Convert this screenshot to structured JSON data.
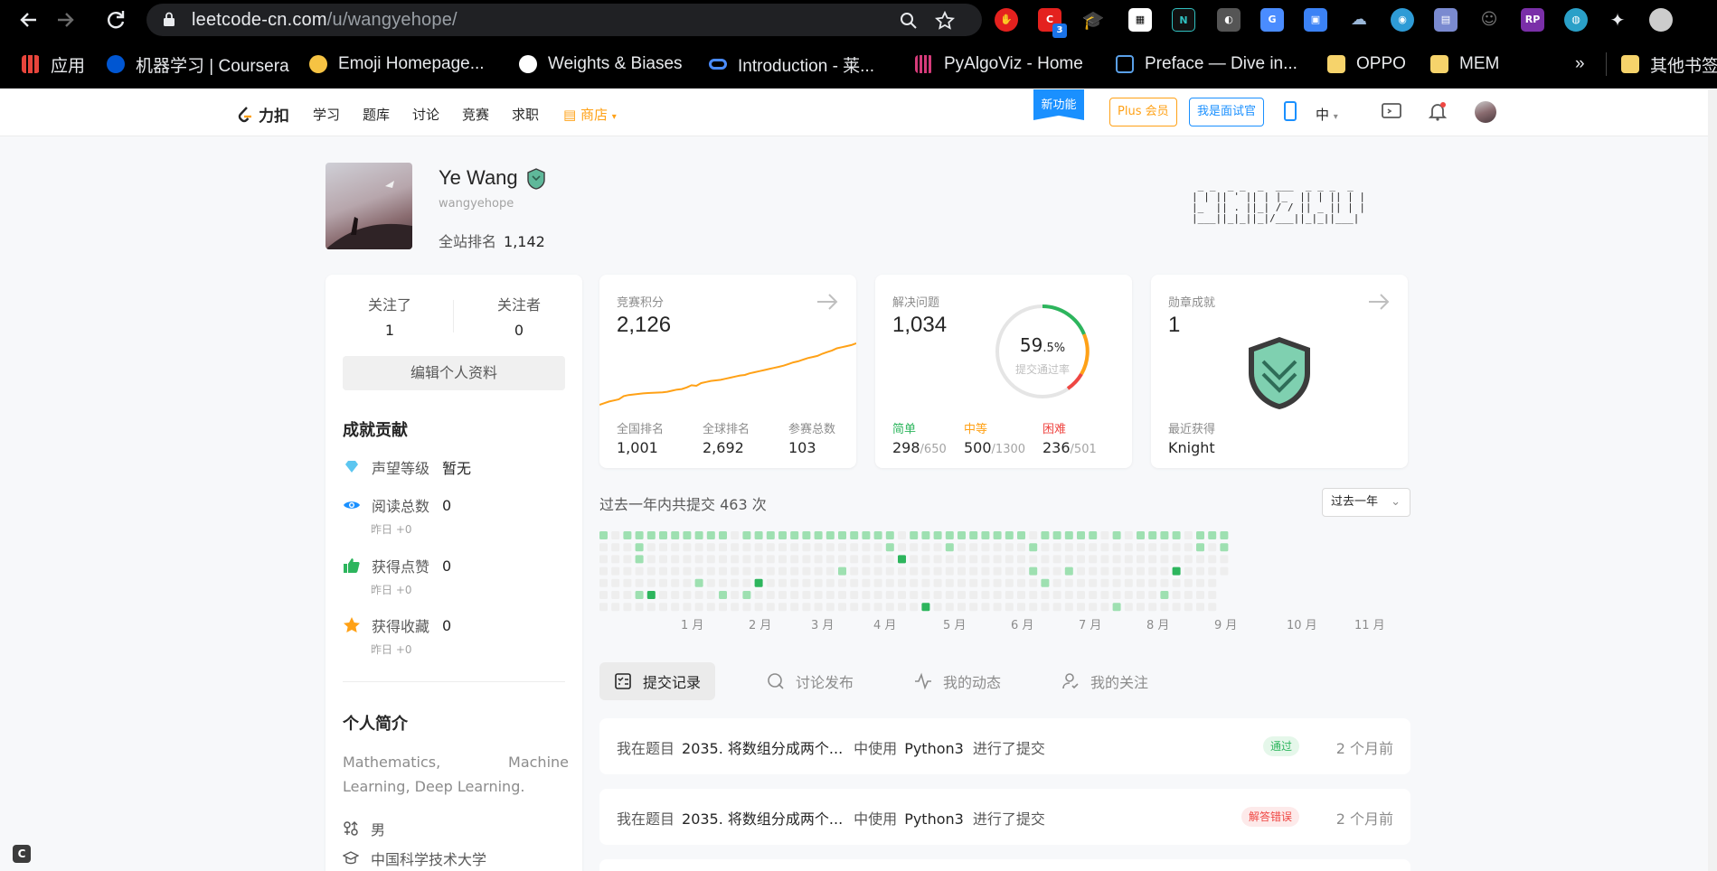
{
  "browser": {
    "url_host": "leetcode-cn.com",
    "url_path": "/u/wangyehope/",
    "bookmarks": [
      {
        "label": "应用",
        "color": "#e8453c"
      },
      {
        "label": "机器学习 | Coursera",
        "color": "#0056d2"
      },
      {
        "label": "Emoji Homepage...",
        "color": "#f6c343"
      },
      {
        "label": "Weights & Biases",
        "color": "#ffffff"
      },
      {
        "label": "Introduction - 莱...",
        "color": "#4a8cff"
      },
      {
        "label": "PyAlgoViz - Home",
        "color": "#d63b7a"
      },
      {
        "label": "Preface — Dive in...",
        "color": "#5aa0e8"
      },
      {
        "label": "OPPO",
        "color": "#f6d36b"
      },
      {
        "label": "MEM",
        "color": "#f6d36b"
      }
    ],
    "bookmarks_overflow": "»",
    "other_bookmarks": "其他书签",
    "extension_badge": "3"
  },
  "site": {
    "logo": "力扣",
    "nav": [
      "学习",
      "题库",
      "讨论",
      "竞赛",
      "求职"
    ],
    "shop": "商店",
    "new_feature": "新功能",
    "plus": "Plus 会员",
    "interviewer": "我是面试官",
    "lang": "中"
  },
  "profile": {
    "name": "Ye Wang",
    "handle": "wangyehope",
    "rank_label": "全站排名",
    "rank_value": "1,142",
    "ascii_art": " _ _  _ _  _  ___  _ _ _  _ \n| | || ' || | |_  || | || | |\n|_  || . ||_| / / || _ || | |\n|___||_|_||_|/___||_|_||___|"
  },
  "left": {
    "following_label": "关注了",
    "following_value": "1",
    "followers_label": "关注者",
    "followers_value": "0",
    "edit_button": "编辑个人资料",
    "achievements_title": "成就贡献",
    "reputation_label": "声望等级",
    "reputation_value": "暂无",
    "views_label": "阅读总数",
    "views_value": "0",
    "views_sub": "昨日 +0",
    "likes_label": "获得点赞",
    "likes_value": "0",
    "likes_sub": "昨日 +0",
    "favs_label": "获得收藏",
    "favs_value": "0",
    "favs_sub": "昨日 +0",
    "bio_title": "个人简介",
    "bio_text": "Mathematics, Machine Learning, Deep Learning.",
    "gender": "男",
    "school": "中国科学技术大学"
  },
  "contest": {
    "title": "竞赛积分",
    "value": "2,126",
    "national_label": "全国排名",
    "national_value": "1,001",
    "global_label": "全球排名",
    "global_value": "2,692",
    "attended_label": "参赛总数",
    "attended_value": "103",
    "trend": [
      1560,
      1575,
      1590,
      1600,
      1610,
      1640,
      1650,
      1655,
      1660,
      1665,
      1668,
      1670,
      1672,
      1675,
      1680,
      1690,
      1700,
      1705,
      1720,
      1740,
      1735,
      1760,
      1770,
      1780,
      1785,
      1790,
      1800,
      1810,
      1820,
      1830,
      1835,
      1850,
      1860,
      1870,
      1880,
      1890,
      1900,
      1910,
      1920,
      1935,
      1950,
      1960,
      1975,
      1990,
      2000,
      2010,
      2030,
      2045,
      2060,
      2080,
      2090,
      2100,
      2110,
      2126
    ]
  },
  "solved": {
    "title": "解决问题",
    "value": "1,034",
    "rate_int": "59",
    "rate_dec": ".5%",
    "rate_label": "提交通过率",
    "easy_label": "简单",
    "easy_value": "298",
    "easy_total": "/650",
    "medium_label": "中等",
    "medium_value": "500",
    "medium_total": "/1300",
    "hard_label": "困难",
    "hard_value": "236",
    "hard_total": "/501",
    "easy_color": "#2db55d",
    "medium_color": "#ffa116",
    "hard_color": "#ef4743"
  },
  "badges": {
    "title": "勋章成就",
    "value": "1",
    "recent_label": "最近获得",
    "recent_value": "Knight"
  },
  "heatmap": {
    "title": "过去一年内共提交 463 次",
    "range": "过去一年",
    "months": [
      "1 月",
      "2 月",
      "3 月",
      "4 月",
      "5 月",
      "6 月",
      "7 月",
      "8 月",
      "9 月",
      "10 月",
      "11 月"
    ]
  },
  "tabs": [
    "提交记录",
    "讨论发布",
    "我的动态",
    "我的关注"
  ],
  "records": [
    {
      "prefix": "我在题目",
      "question": "2035. 将数组分成两个...",
      "mid": "中使用",
      "lang": "Python3",
      "suffix": "进行了提交",
      "status": "通过",
      "status_type": "ok",
      "time": "2 个月前"
    },
    {
      "prefix": "我在题目",
      "question": "2035. 将数组分成两个...",
      "mid": "中使用",
      "lang": "Python3",
      "suffix": "进行了提交",
      "status": "解答错误",
      "status_type": "bad",
      "time": "2 个月前"
    }
  ]
}
